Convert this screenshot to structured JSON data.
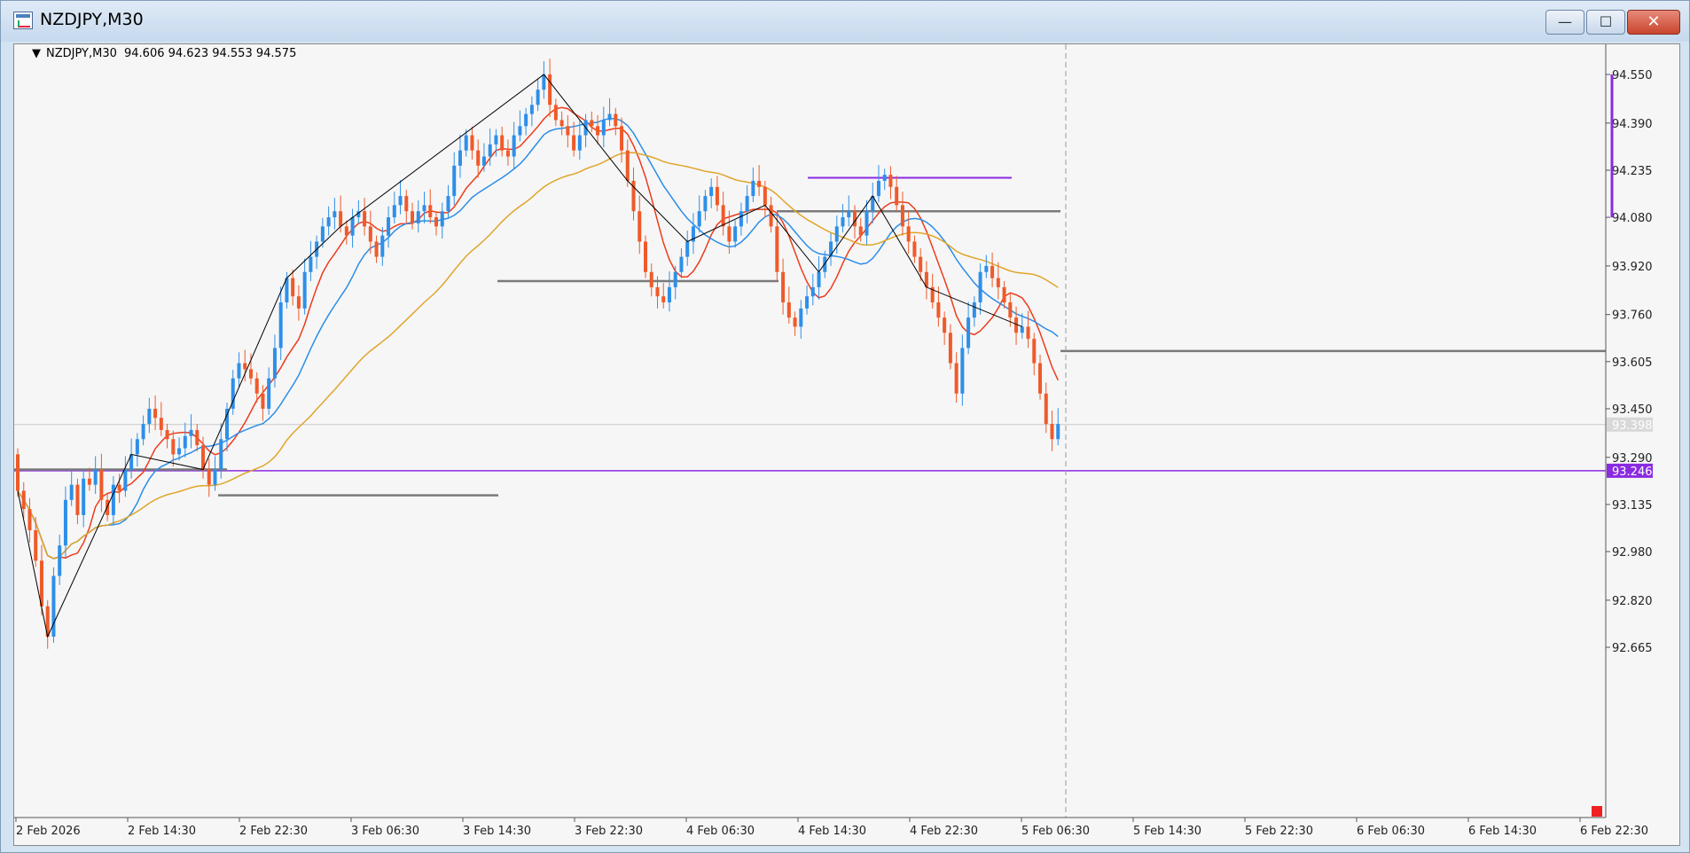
{
  "window": {
    "title": "NZDJPY,M30",
    "buttons": {
      "minimize": "—",
      "maximize": "☐",
      "close": "✕"
    }
  },
  "chart_info": {
    "symbol_tf": "NZDJPY,M30",
    "ohlc": "94.606 94.623 94.553 94.575"
  },
  "price_labels": {
    "current": "93.398",
    "level_purple": "93.246"
  },
  "colors": {
    "background": "#f6f6f6",
    "bull": "#2e8fe8",
    "bear": "#ef5a2a",
    "ma_fast": "#ee3b1c",
    "ma_mid": "#2b8ee8",
    "ma_slow": "#e0a52a",
    "zigzag": "#000000",
    "level_purple": "#8a2be2",
    "level_gray": "#7a7a7a"
  },
  "chart_data": {
    "type": "candlestick",
    "symbol": "NZDJPY",
    "timeframe": "M30",
    "y_ticks": [
      94.55,
      94.39,
      94.235,
      94.08,
      93.92,
      93.76,
      93.605,
      93.45,
      93.29,
      93.135,
      92.98,
      92.82,
      92.665
    ],
    "y_tick_labels": [
      "94.550",
      "94.390",
      "94.235",
      "94.080",
      "93.920",
      "93.760",
      "93.605",
      "93.450",
      "93.290",
      "93.135",
      "92.980",
      "92.820",
      "92.665"
    ],
    "x_labels": [
      "2 Feb 2026",
      "2 Feb 14:30",
      "2 Feb 22:30",
      "3 Feb 06:30",
      "3 Feb 14:30",
      "3 Feb 22:30",
      "4 Feb 06:30",
      "4 Feb 14:30",
      "4 Feb 22:30",
      "5 Feb 06:30",
      "5 Feb 14:30",
      "5 Feb 22:30",
      "6 Feb 06:30",
      "6 Feb 14:30",
      "6 Feb 22:30"
    ],
    "current_price": 93.398,
    "horizontal_levels": [
      {
        "price": 93.246,
        "color": "purple",
        "label": "93.246"
      },
      {
        "price": 93.64,
        "color": "gray"
      },
      {
        "price": 94.1,
        "color": "gray"
      },
      {
        "price": 94.21,
        "color": "purple"
      },
      {
        "price": 93.87,
        "color": "gray"
      },
      {
        "price": 93.165,
        "color": "gray"
      },
      {
        "price": 93.25,
        "color": "gray"
      }
    ],
    "close_series": [
      93.18,
      93.12,
      93.05,
      92.95,
      92.8,
      92.7,
      92.9,
      93.0,
      93.15,
      93.2,
      93.1,
      93.22,
      93.2,
      93.25,
      93.15,
      93.1,
      93.2,
      93.18,
      93.25,
      93.3,
      93.35,
      93.4,
      93.45,
      93.42,
      93.38,
      93.35,
      93.3,
      93.32,
      93.36,
      93.38,
      93.33,
      93.25,
      93.2,
      93.25,
      93.35,
      93.45,
      93.55,
      93.6,
      93.58,
      93.55,
      93.5,
      93.45,
      93.55,
      93.65,
      93.8,
      93.88,
      93.82,
      93.78,
      93.9,
      93.95,
      94.0,
      94.05,
      94.08,
      94.1,
      94.05,
      94.02,
      94.08,
      94.1,
      94.05,
      94.0,
      93.95,
      94.02,
      94.08,
      94.12,
      94.15,
      94.1,
      94.06,
      94.1,
      94.12,
      94.08,
      94.05,
      94.1,
      94.15,
      94.25,
      94.3,
      94.35,
      94.3,
      94.25,
      94.28,
      94.32,
      94.35,
      94.3,
      94.28,
      94.35,
      94.38,
      94.42,
      94.45,
      94.5,
      94.55,
      94.45,
      94.4,
      94.38,
      94.35,
      94.3,
      94.35,
      94.4,
      94.38,
      94.35,
      94.4,
      94.42,
      94.38,
      94.3,
      94.2,
      94.1,
      94.0,
      93.9,
      93.85,
      93.82,
      93.8,
      93.85,
      93.9,
      93.95,
      94.0,
      94.05,
      94.1,
      94.15,
      94.18,
      94.12,
      94.05,
      94.0,
      94.05,
      94.1,
      94.15,
      94.2,
      94.18,
      94.12,
      94.05,
      93.9,
      93.8,
      93.75,
      93.72,
      93.78,
      93.82,
      93.85,
      93.9,
      93.95,
      94.0,
      94.05,
      94.08,
      94.1,
      94.05,
      94.02,
      94.1,
      94.15,
      94.2,
      94.22,
      94.18,
      94.12,
      94.05,
      94.0,
      93.95,
      93.9,
      93.85,
      93.8,
      93.75,
      93.7,
      93.6,
      93.5,
      93.65,
      93.75,
      93.8,
      93.9,
      93.92,
      93.88,
      93.85,
      93.8,
      93.75,
      93.7,
      93.72,
      93.68,
      93.6,
      93.5,
      93.4,
      93.35,
      93.4
    ]
  }
}
